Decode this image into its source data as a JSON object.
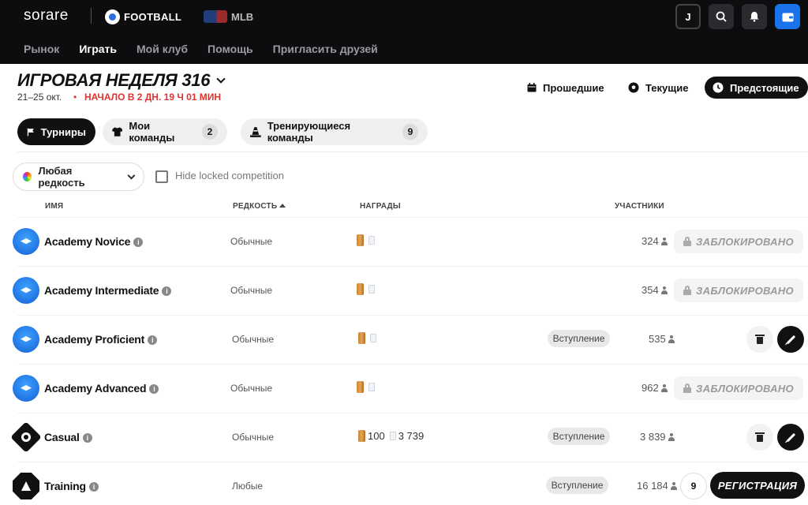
{
  "topbar": {
    "brand": "sorare",
    "sports": [
      {
        "label": "FOOTBALL",
        "icon": "football-icon"
      },
      {
        "label": "MLB",
        "icon": "mlb-logo-icon"
      }
    ],
    "avatar_initial": "J",
    "accent_color": "#1a73e8"
  },
  "nav": {
    "items": [
      "Рынок",
      "Играть",
      "Мой клуб",
      "Помощь",
      "Пригласить друзей"
    ],
    "active": "Играть"
  },
  "gameweek": {
    "title": "ИГРОВАЯ НЕДЕЛЯ 316",
    "dates": "21–25 окт.",
    "separator": "•",
    "countdown": "НАЧАЛО В 2 ДН. 19 Ч 01 МИН"
  },
  "period_filters": {
    "past": "Прошедшие",
    "current": "Текущие",
    "upcoming": "Предстоящие",
    "active": "Предстоящие"
  },
  "tabs": [
    {
      "label": "Турниры",
      "count": null,
      "icon": "flag-icon"
    },
    {
      "label": "Мои команды",
      "count": "2",
      "icon": "shirt-icon"
    },
    {
      "label": "Тренирующиеся команды",
      "count": "9",
      "icon": "cone-icon"
    }
  ],
  "rarity_filter": {
    "label": "Любая редкость"
  },
  "hide_locked": {
    "label": "Hide locked competition",
    "checked": false
  },
  "table": {
    "headers": {
      "name": "ИМЯ",
      "rarity": "РЕДКОСТЬ",
      "rewards": "НАГРАДЫ",
      "players": "УЧАСТНИКИ"
    },
    "rows": [
      {
        "name": "Academy Novice",
        "rarity": "Обычные",
        "coin_reward": "",
        "card_reward": "",
        "entry": "",
        "players": "324",
        "action": "ЗАБЛОКИРОВАНО"
      },
      {
        "name": "Academy Intermediate",
        "rarity": "Обычные",
        "coin_reward": "",
        "card_reward": "",
        "entry": "",
        "players": "354",
        "action": "ЗАБЛОКИРОВАНО"
      },
      {
        "name": "Academy Proficient",
        "rarity": "Обычные",
        "coin_reward": "",
        "card_reward": "",
        "entry": "Вступление",
        "players": "535",
        "action": ""
      },
      {
        "name": "Academy Advanced",
        "rarity": "Обычные",
        "coin_reward": "",
        "card_reward": "",
        "entry": "",
        "players": "962",
        "action": "ЗАБЛОКИРОВАНО"
      },
      {
        "name": "Casual",
        "rarity": "Обычные",
        "coin_reward": "100",
        "card_reward": "3 739",
        "entry": "Вступление",
        "players": "3 839",
        "action": ""
      },
      {
        "name": "Training",
        "rarity": "Любые",
        "coin_reward": "",
        "card_reward": "",
        "entry": "Вступление",
        "players": "16 184",
        "action": "РЕГИСТРАЦИЯ",
        "team_count": "9"
      }
    ]
  },
  "colors": {
    "countdown": "#e0332f",
    "academy_icon": "#1f7ae8",
    "dark": "#111111"
  }
}
